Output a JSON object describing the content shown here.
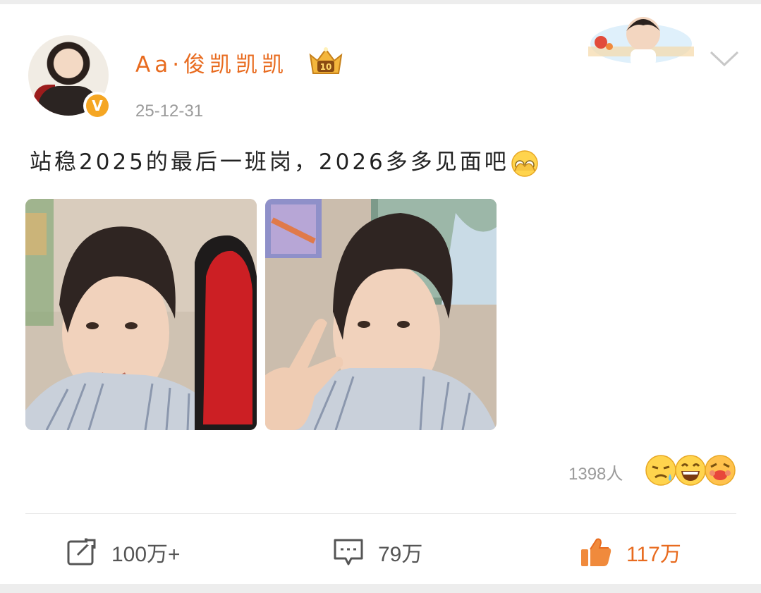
{
  "user": {
    "name": "Aa·俊凯凯凯",
    "verified_badge": "V",
    "post_time": "25-12-31"
  },
  "post": {
    "text": "站稳2025的最后一班岗，2026多多见面吧",
    "inline_emoji": "peeking-emoji-icon"
  },
  "reactions": {
    "count_label": "1398人",
    "emojis": [
      "crying-emoji-icon",
      "laughing-emoji-icon",
      "blushing-emoji-icon"
    ]
  },
  "actions": {
    "repost_count": "100万+",
    "comment_count": "79万",
    "like_count": "117万"
  },
  "colors": {
    "accent": "#e86b1f",
    "muted": "#9b9b9b",
    "text": "#222222"
  }
}
